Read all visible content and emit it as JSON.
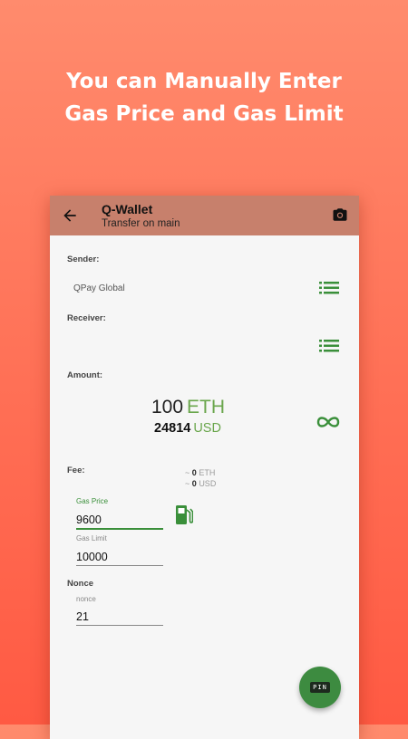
{
  "promo": {
    "line1": "You can Manually Enter",
    "line2": "Gas Price and Gas Limit"
  },
  "appbar": {
    "title": "Q-Wallet",
    "subtitle": "Transfer on main",
    "back_icon": "arrow-back-icon",
    "camera_icon": "camera-icon",
    "color": "#c7806c"
  },
  "sender": {
    "label": "Sender:",
    "value": "QPay Global"
  },
  "receiver": {
    "label": "Receiver:",
    "value": ""
  },
  "amount": {
    "label": "Amount:",
    "eth_value": "100",
    "eth_unit": "ETH",
    "usd_value": "24814",
    "usd_unit": "USD"
  },
  "fee": {
    "label": "Fee:",
    "eth_prefix": "~",
    "eth_value": "0",
    "eth_unit": "ETH",
    "usd_prefix": "~",
    "usd_value": "0",
    "usd_unit": "USD"
  },
  "gas_price": {
    "label": "Gas Price",
    "value": "9600"
  },
  "gas_limit": {
    "label": "Gas Limit",
    "value": "10000"
  },
  "nonce": {
    "label": "Nonce",
    "field_label": "nonce",
    "value": "21"
  },
  "pin_button": {
    "label": "PIN"
  },
  "colors": {
    "accent_green": "#3a8f3a",
    "unit_green": "#6aa64c",
    "background_top": "#ff8b6d",
    "background_bottom": "#ff5a43"
  }
}
